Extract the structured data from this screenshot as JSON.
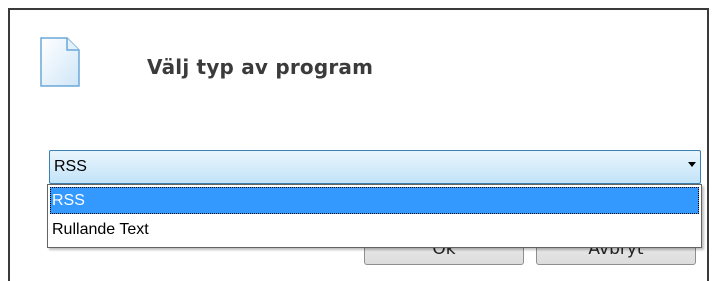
{
  "dialog": {
    "title": "Välj typ av program",
    "icon": "document-icon"
  },
  "combo": {
    "selected_value": "RSS",
    "options": [
      "RSS",
      "Rullande Text"
    ]
  },
  "buttons": {
    "ok_label": "Ok",
    "cancel_label": "Avbryt"
  },
  "colors": {
    "selection": "#3399ff",
    "combo_border": "#3c7fb1",
    "title_text": "#3b3b3b"
  }
}
